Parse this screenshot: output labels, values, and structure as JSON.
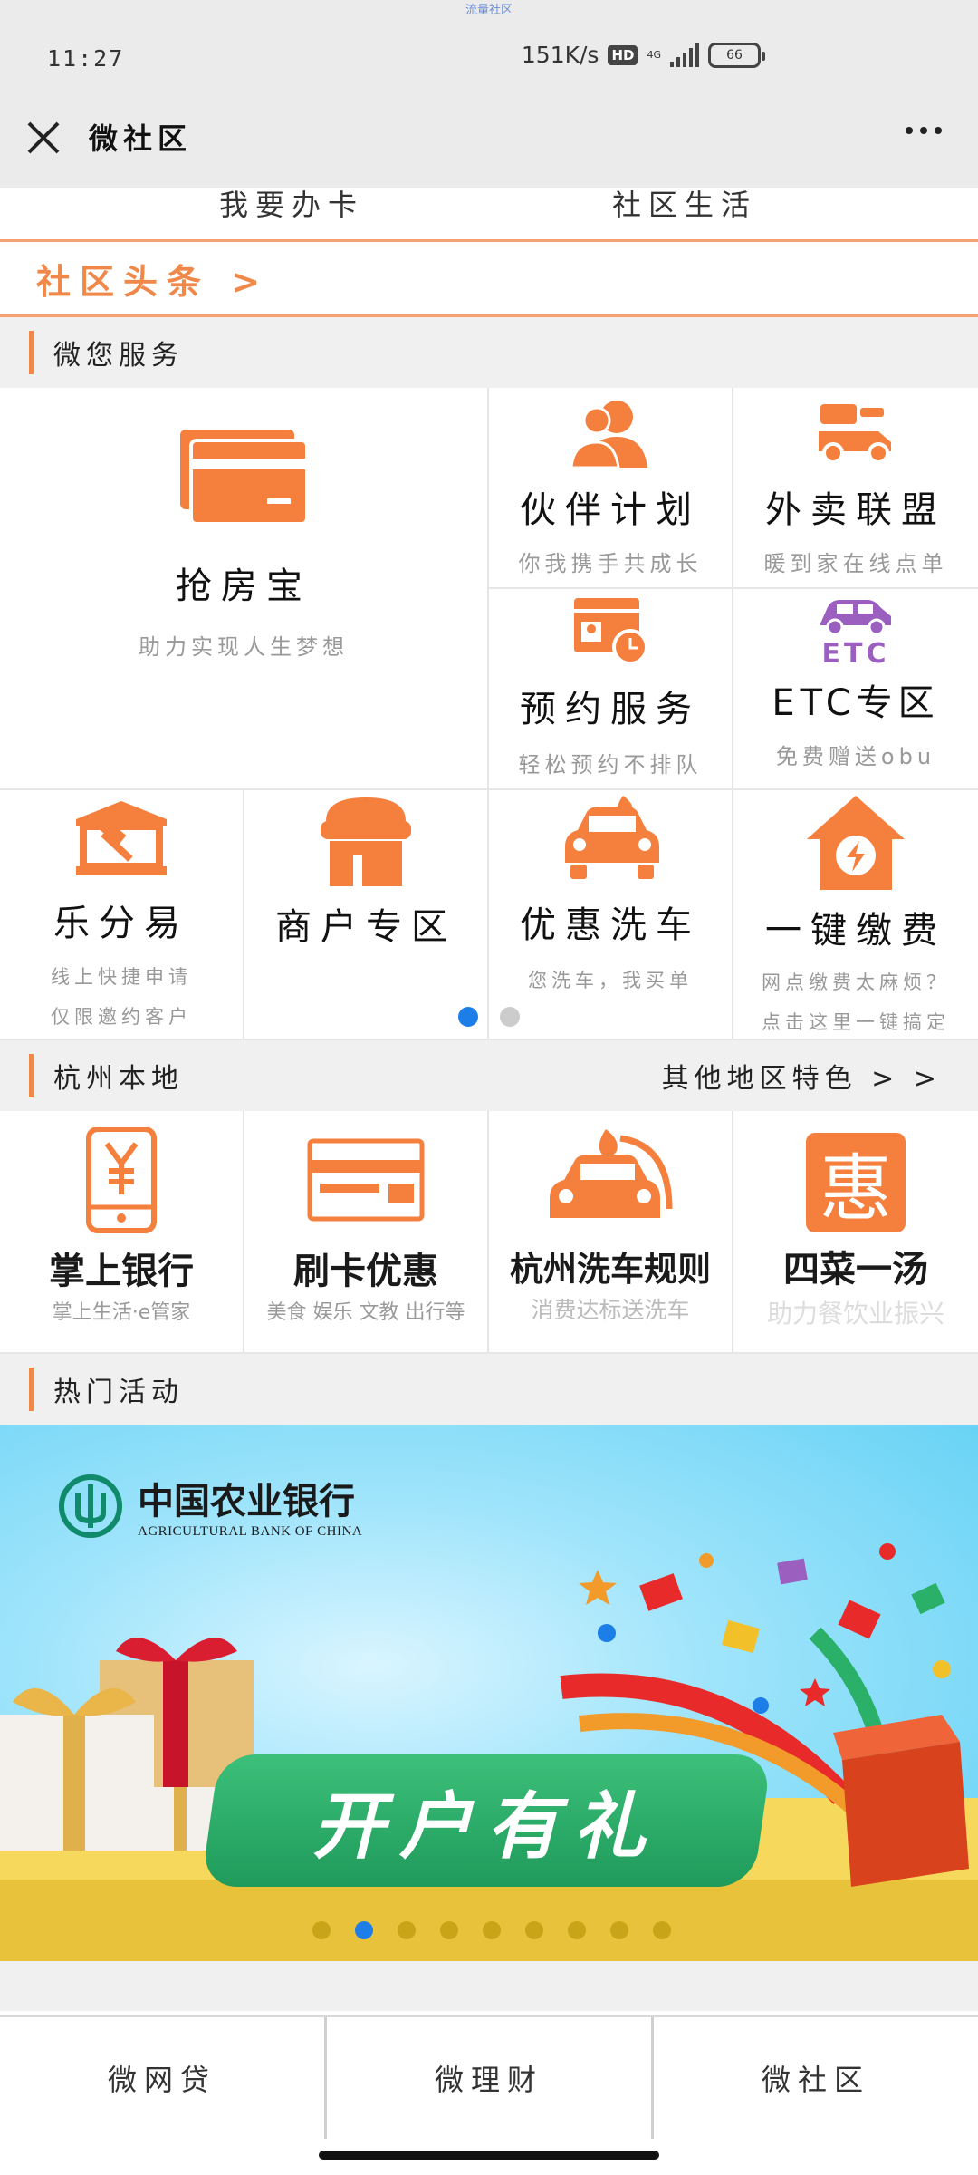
{
  "status_bar": {
    "caption": "流量社区",
    "time": "11:27",
    "speed": "151K/s",
    "hd": "HD",
    "network": "4G",
    "battery": "66"
  },
  "title_bar": {
    "title": "微社区"
  },
  "quick_links": [
    "我要办卡",
    "社区生活"
  ],
  "headline": {
    "label": "社区头条 >"
  },
  "services_section": {
    "title": "微您服务"
  },
  "services": {
    "big": {
      "name": "抢房宝",
      "desc": "助力实现人生梦想"
    },
    "partner": {
      "name": "伙伴计划",
      "desc": "你我携手共成长"
    },
    "takeout": {
      "name": "外卖联盟",
      "desc": "暖到家在线点单"
    },
    "booking": {
      "name": "预约服务",
      "desc": "轻松预约不排队"
    },
    "etc": {
      "name": "ETC专区",
      "desc": "免费赠送obu",
      "icon_text": "ETC"
    },
    "installment": {
      "name": "乐分易",
      "desc1": "线上快捷申请",
      "desc2": "仅限邀约客户"
    },
    "merchant": {
      "name": "商户专区"
    },
    "carwash": {
      "name": "优惠洗车",
      "desc": "您洗车，我买单"
    },
    "payment": {
      "name": "一键缴费",
      "desc1": "网点缴费太麻烦？",
      "desc2": "点击这里一键搞定"
    }
  },
  "local_section": {
    "title": "杭州本地",
    "other_link": "其他地区特色 > >"
  },
  "local_items": [
    {
      "name": "掌上银行",
      "sub": "掌上生活·e管家"
    },
    {
      "name": "刷卡优惠",
      "sub": "美食 娱乐 文教 出行等"
    },
    {
      "name": "杭州洗车规则",
      "sub": "消费达标送洗车"
    },
    {
      "name": "四菜一汤",
      "sub": "助力餐饮业振兴",
      "icon_text": "惠"
    }
  ],
  "hot_section": {
    "title": "热门活动"
  },
  "banner": {
    "bank_name": "中国农业银行",
    "bank_en": "AGRICULTURAL BANK OF CHINA",
    "slogan": "开户有礼",
    "page_count": 9,
    "active_page": 2
  },
  "bottom_nav": [
    {
      "label": "微网贷"
    },
    {
      "label": "微理财"
    },
    {
      "label": "微社区"
    }
  ],
  "colors": {
    "accent": "#f0884a",
    "icon_orange": "#f57f3c",
    "etc_purple": "#9b5fc0",
    "active_dot": "#1e7ee8",
    "promo_green": "#2bb06a"
  }
}
